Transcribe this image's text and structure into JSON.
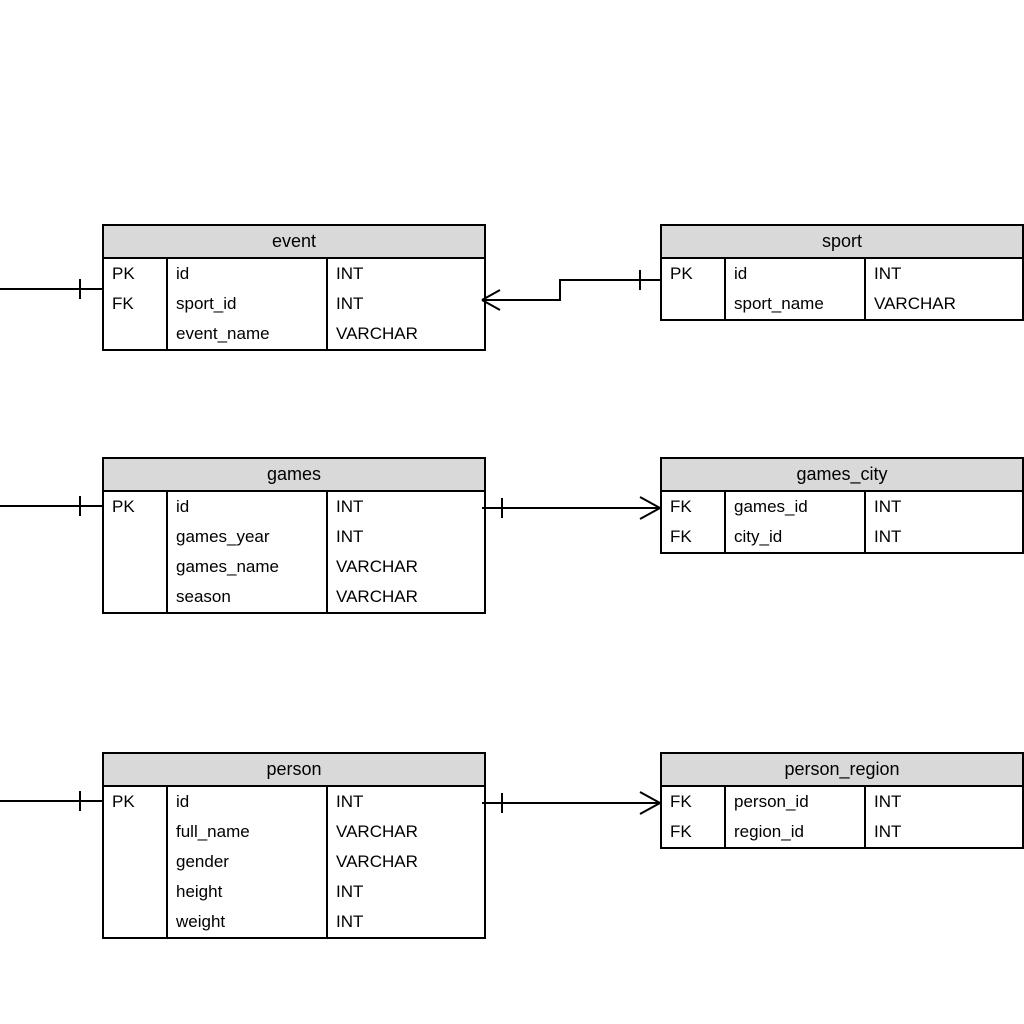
{
  "diagram": {
    "kind": "entity-relationship",
    "entities": {
      "event": {
        "title": "event",
        "columns": [
          {
            "key": "PK",
            "name": "id",
            "type": "INT"
          },
          {
            "key": "FK",
            "name": "sport_id",
            "type": "INT"
          },
          {
            "key": "",
            "name": "event_name",
            "type": "VARCHAR"
          }
        ]
      },
      "sport": {
        "title": "sport",
        "columns": [
          {
            "key": "PK",
            "name": "id",
            "type": "INT"
          },
          {
            "key": "",
            "name": "sport_name",
            "type": "VARCHAR"
          }
        ]
      },
      "games": {
        "title": "games",
        "columns": [
          {
            "key": "PK",
            "name": "id",
            "type": "INT"
          },
          {
            "key": "",
            "name": "games_year",
            "type": "INT"
          },
          {
            "key": "",
            "name": "games_name",
            "type": "VARCHAR"
          },
          {
            "key": "",
            "name": "season",
            "type": "VARCHAR"
          }
        ]
      },
      "games_city": {
        "title": "games_city",
        "columns": [
          {
            "key": "FK",
            "name": "games_id",
            "type": "INT"
          },
          {
            "key": "FK",
            "name": "city_id",
            "type": "INT"
          }
        ]
      },
      "person": {
        "title": "person",
        "columns": [
          {
            "key": "PK",
            "name": "id",
            "type": "INT"
          },
          {
            "key": "",
            "name": "full_name",
            "type": "VARCHAR"
          },
          {
            "key": "",
            "name": "gender",
            "type": "VARCHAR"
          },
          {
            "key": "",
            "name": "height",
            "type": "INT"
          },
          {
            "key": "",
            "name": "weight",
            "type": "INT"
          }
        ]
      },
      "person_region": {
        "title": "person_region",
        "columns": [
          {
            "key": "FK",
            "name": "person_id",
            "type": "INT"
          },
          {
            "key": "FK",
            "name": "region_id",
            "type": "INT"
          }
        ]
      }
    },
    "relations": [
      {
        "from": "event",
        "to": "sport",
        "type": "many-to-one"
      },
      {
        "from": "games_city",
        "to": "games",
        "type": "many-to-one"
      },
      {
        "from": "person_region",
        "to": "person",
        "type": "many-to-one"
      },
      {
        "from": "event",
        "to": "offscreen-left",
        "type": "one-end"
      },
      {
        "from": "games",
        "to": "offscreen-left",
        "type": "one-end"
      },
      {
        "from": "person",
        "to": "offscreen-left",
        "type": "one-end"
      }
    ]
  }
}
